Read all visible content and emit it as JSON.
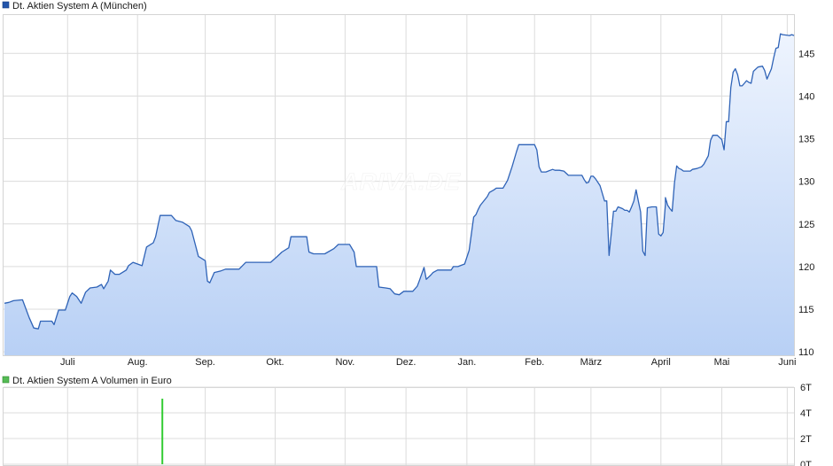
{
  "chart_data": [
    {
      "type": "area",
      "title": "Dt. Aktien System A (München)",
      "legend_position": "top-left",
      "grid": true,
      "colors": {
        "line": "#2f63b7",
        "fill_top": "#eef4fe",
        "fill_bottom": "#b8d0f5",
        "legend_swatch": "#2255aa",
        "grid": "#dcdcdc"
      },
      "watermark": "ARIVA.DE",
      "x_ticks": [
        "Juli",
        "Aug.",
        "Sep.",
        "Okt.",
        "Nov.",
        "Dez.",
        "Jan.",
        "Feb.",
        "März",
        "April",
        "Mai",
        "Juni"
      ],
      "y_ticks": [
        "110",
        "115",
        "120",
        "125",
        "130",
        "135",
        "140",
        "145"
      ],
      "ylim": [
        109.6,
        149.5
      ],
      "xlim": [
        0,
        348
      ],
      "x_tick_positions": [
        28,
        59,
        89,
        120,
        151,
        178,
        205,
        235,
        260,
        291,
        318,
        347
      ],
      "series": [
        {
          "points": [
            [
              0,
              115.7
            ],
            [
              2,
              115.8
            ],
            [
              4,
              116.0
            ],
            [
              8,
              116.1
            ],
            [
              11,
              114.0
            ],
            [
              13,
              112.8
            ],
            [
              15,
              112.7
            ],
            [
              16,
              113.6
            ],
            [
              21,
              113.6
            ],
            [
              22,
              113.2
            ],
            [
              24,
              114.9
            ],
            [
              27,
              114.9
            ],
            [
              29,
              116.5
            ],
            [
              30,
              116.9
            ],
            [
              32,
              116.5
            ],
            [
              34,
              115.7
            ],
            [
              36,
              117.0
            ],
            [
              38,
              117.5
            ],
            [
              41,
              117.6
            ],
            [
              43,
              117.9
            ],
            [
              44,
              117.4
            ],
            [
              46,
              118.3
            ],
            [
              47,
              119.6
            ],
            [
              49,
              119.1
            ],
            [
              51,
              119.1
            ],
            [
              54,
              119.6
            ],
            [
              55,
              120.1
            ],
            [
              57,
              120.5
            ],
            [
              61,
              120.1
            ],
            [
              63,
              122.3
            ],
            [
              66,
              122.8
            ],
            [
              67,
              123.5
            ],
            [
              69,
              126.0
            ],
            [
              74,
              126.0
            ],
            [
              76,
              125.4
            ],
            [
              79,
              125.2
            ],
            [
              82,
              124.7
            ],
            [
              83,
              124.2
            ],
            [
              86,
              121.2
            ],
            [
              89,
              120.7
            ],
            [
              90,
              118.3
            ],
            [
              91,
              118.1
            ],
            [
              93,
              119.3
            ],
            [
              96,
              119.5
            ],
            [
              98,
              119.7
            ],
            [
              104,
              119.7
            ],
            [
              107,
              120.5
            ],
            [
              118,
              120.5
            ],
            [
              121,
              121.2
            ],
            [
              123,
              121.7
            ],
            [
              126,
              122.2
            ],
            [
              127,
              123.5
            ],
            [
              134,
              123.5
            ],
            [
              135,
              121.7
            ],
            [
              137,
              121.5
            ],
            [
              142,
              121.5
            ],
            [
              146,
              122.1
            ],
            [
              148,
              122.6
            ],
            [
              153,
              122.6
            ],
            [
              155,
              121.7
            ],
            [
              156,
              120.0
            ],
            [
              163,
              120.0
            ],
            [
              165,
              120.0
            ],
            [
              166,
              117.6
            ],
            [
              169,
              117.5
            ],
            [
              171,
              117.4
            ],
            [
              173,
              116.8
            ],
            [
              175,
              116.7
            ],
            [
              177,
              117.1
            ],
            [
              181,
              117.1
            ],
            [
              183,
              117.7
            ],
            [
              184,
              118.4
            ],
            [
              186,
              119.9
            ],
            [
              187,
              118.5
            ],
            [
              189,
              119.0
            ],
            [
              190,
              119.3
            ],
            [
              192,
              119.6
            ],
            [
              198,
              119.6
            ],
            [
              199,
              120.0
            ],
            [
              201,
              120.0
            ],
            [
              204,
              120.3
            ],
            [
              206,
              121.9
            ],
            [
              208,
              125.8
            ],
            [
              209,
              126.1
            ],
            [
              210,
              126.7
            ],
            [
              211,
              127.2
            ],
            [
              214,
              128.2
            ],
            [
              215,
              128.7
            ],
            [
              217,
              129.0
            ],
            [
              218,
              129.2
            ],
            [
              221,
              129.2
            ],
            [
              223,
              130.1
            ],
            [
              225,
              131.7
            ],
            [
              227,
              133.5
            ],
            [
              228,
              134.3
            ],
            [
              235,
              134.3
            ],
            [
              236,
              133.7
            ],
            [
              237,
              131.7
            ],
            [
              238,
              131.1
            ],
            [
              240,
              131.1
            ],
            [
              243,
              131.4
            ],
            [
              244,
              131.3
            ],
            [
              246,
              131.3
            ],
            [
              248,
              131.2
            ],
            [
              250,
              130.7
            ],
            [
              252,
              130.7
            ],
            [
              256,
              130.7
            ],
            [
              257,
              130.2
            ],
            [
              258,
              129.8
            ],
            [
              259,
              129.9
            ],
            [
              260,
              130.6
            ],
            [
              261,
              130.6
            ],
            [
              262,
              130.3
            ],
            [
              264,
              129.5
            ],
            [
              266,
              127.7
            ],
            [
              267,
              127.7
            ],
            [
              268,
              121.3
            ],
            [
              270,
              126.5
            ],
            [
              271,
              126.5
            ],
            [
              272,
              127.0
            ],
            [
              274,
              126.8
            ],
            [
              275,
              126.6
            ],
            [
              276,
              126.6
            ],
            [
              277,
              126.4
            ],
            [
              278,
              127.0
            ],
            [
              279,
              127.7
            ],
            [
              280,
              129.0
            ],
            [
              281,
              127.7
            ],
            [
              282,
              126.4
            ],
            [
              283,
              121.8
            ],
            [
              284,
              121.3
            ],
            [
              285,
              126.9
            ],
            [
              287,
              127.0
            ],
            [
              289,
              127.0
            ],
            [
              290,
              123.8
            ],
            [
              291,
              123.6
            ],
            [
              292,
              124.0
            ],
            [
              293,
              127.3
            ],
            [
              293,
              128.1
            ],
            [
              294,
              127.2
            ],
            [
              295,
              126.8
            ],
            [
              296,
              126.5
            ],
            [
              297,
              129.8
            ],
            [
              298,
              131.8
            ],
            [
              299,
              131.5
            ],
            [
              300,
              131.4
            ],
            [
              301,
              131.2
            ],
            [
              304,
              131.2
            ],
            [
              305,
              131.4
            ],
            [
              307,
              131.5
            ],
            [
              309,
              131.7
            ],
            [
              310,
              132.0
            ],
            [
              312,
              133.0
            ],
            [
              313,
              134.8
            ],
            [
              314,
              135.4
            ],
            [
              316,
              135.4
            ],
            [
              318,
              134.9
            ],
            [
              319,
              133.7
            ],
            [
              320,
              137.0
            ],
            [
              321,
              137.0
            ],
            [
              322,
              141.0
            ],
            [
              323,
              142.8
            ],
            [
              324,
              143.2
            ],
            [
              325,
              142.5
            ],
            [
              326,
              141.2
            ],
            [
              327,
              141.2
            ],
            [
              328,
              141.5
            ],
            [
              329,
              141.8
            ],
            [
              330,
              141.6
            ],
            [
              331,
              141.5
            ],
            [
              332,
              142.9
            ],
            [
              334,
              143.4
            ],
            [
              336,
              143.5
            ],
            [
              337,
              143.0
            ],
            [
              338,
              142.0
            ],
            [
              339,
              142.6
            ],
            [
              340,
              143.2
            ],
            [
              341,
              144.5
            ],
            [
              342,
              145.6
            ],
            [
              343,
              145.7
            ],
            [
              344,
              147.3
            ],
            [
              345,
              147.2
            ],
            [
              348,
              147.1
            ],
            [
              349,
              147.2
            ],
            [
              350,
              147.1
            ]
          ]
        }
      ]
    },
    {
      "type": "bar",
      "title": "Dt. Aktien System A Volumen in Euro",
      "legend_position": "top-left",
      "grid": true,
      "colors": {
        "bar": "#33cc33",
        "legend_swatch": "#55bb55",
        "grid": "#dcdcdc"
      },
      "y_ticks": [
        "0T",
        "2T",
        "4T",
        "6T"
      ],
      "ylim": [
        0,
        6
      ],
      "xlim": [
        0,
        348
      ],
      "x_tick_positions": [
        28,
        59,
        89,
        120,
        151,
        178,
        205,
        235,
        260,
        291,
        318,
        347
      ],
      "bars": [
        {
          "x": 70,
          "value": 5.1
        }
      ]
    }
  ]
}
